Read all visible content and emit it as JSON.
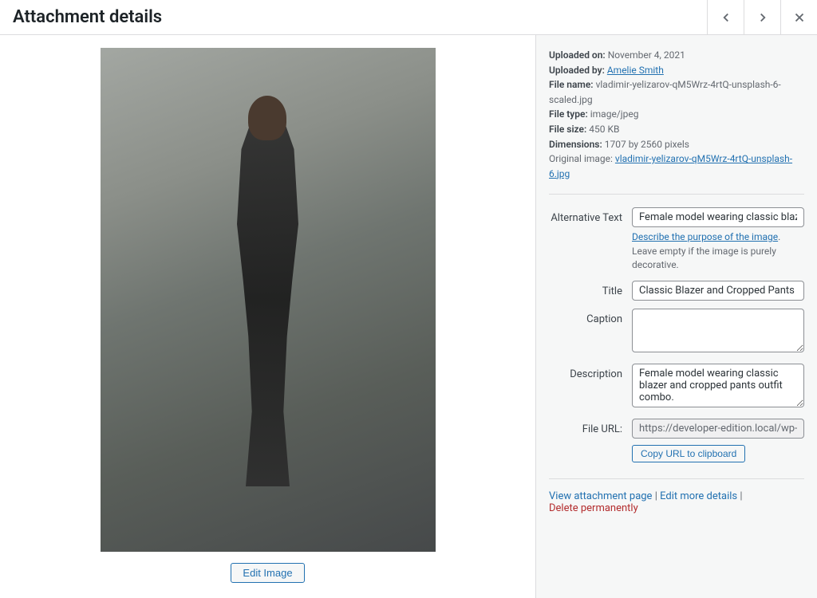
{
  "header": {
    "title": "Attachment details"
  },
  "details": {
    "uploaded_on_label": "Uploaded on:",
    "uploaded_on": "November 4, 2021",
    "uploaded_by_label": "Uploaded by:",
    "uploaded_by": "Amelie Smith",
    "file_name_label": "File name:",
    "file_name": "vladimir-yelizarov-qM5Wrz-4rtQ-unsplash-6-scaled.jpg",
    "file_type_label": "File type:",
    "file_type": "image/jpeg",
    "file_size_label": "File size:",
    "file_size": "450 KB",
    "dimensions_label": "Dimensions:",
    "dimensions": "1707 by 2560 pixels",
    "original_image_label": "Original image:",
    "original_image": "vladimir-yelizarov-qM5Wrz-4rtQ-unsplash-6.jpg"
  },
  "fields": {
    "alt_text": {
      "label": "Alternative Text",
      "value": "Female model wearing classic blazer and cropped pants outfit combo.",
      "help_link": "Describe the purpose of the image",
      "help_text": ". Leave empty if the image is purely decorative."
    },
    "title": {
      "label": "Title",
      "value": "Classic Blazer and Cropped Pants Outfit"
    },
    "caption": {
      "label": "Caption",
      "value": ""
    },
    "description": {
      "label": "Description",
      "value": "Female model wearing classic blazer and cropped pants outfit combo."
    },
    "file_url": {
      "label": "File URL:",
      "value": "https://developer-edition.local/wp-content/uploads/...",
      "copy_label": "Copy URL to clipboard"
    }
  },
  "buttons": {
    "edit_image": "Edit Image"
  },
  "actions": {
    "view": "View attachment page",
    "edit_more": "Edit more details",
    "delete": "Delete permanently",
    "sep": " | "
  }
}
